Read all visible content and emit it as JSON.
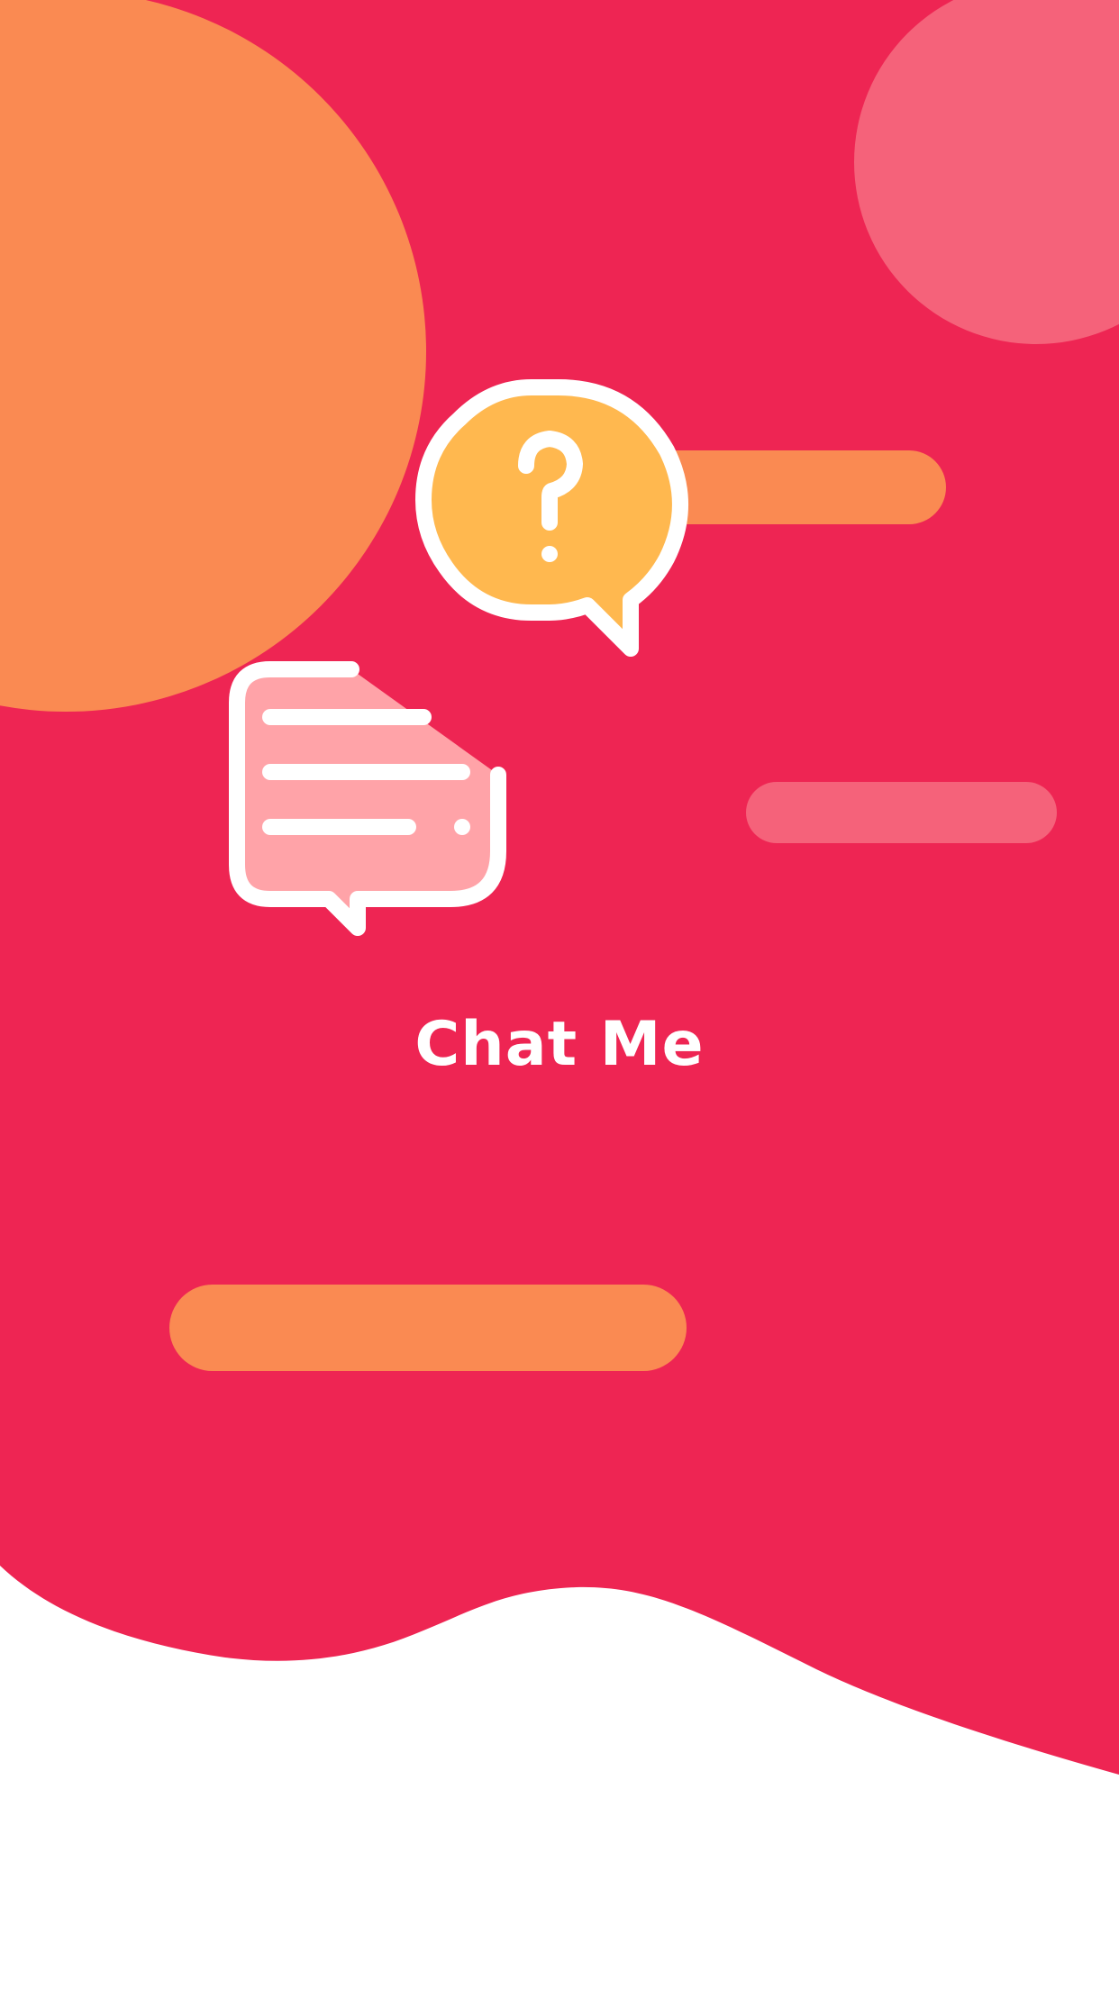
{
  "screen": {
    "title": "Chat Me",
    "icon": "chat-question-bubbles-icon"
  },
  "colors": {
    "background": "#EE2553",
    "orange": "#FA8A52",
    "light_pink": "#F5627A",
    "yellow_bubble": "#FFB84F",
    "pink_bubble": "#FFA3A8",
    "white": "#FFFFFF"
  }
}
